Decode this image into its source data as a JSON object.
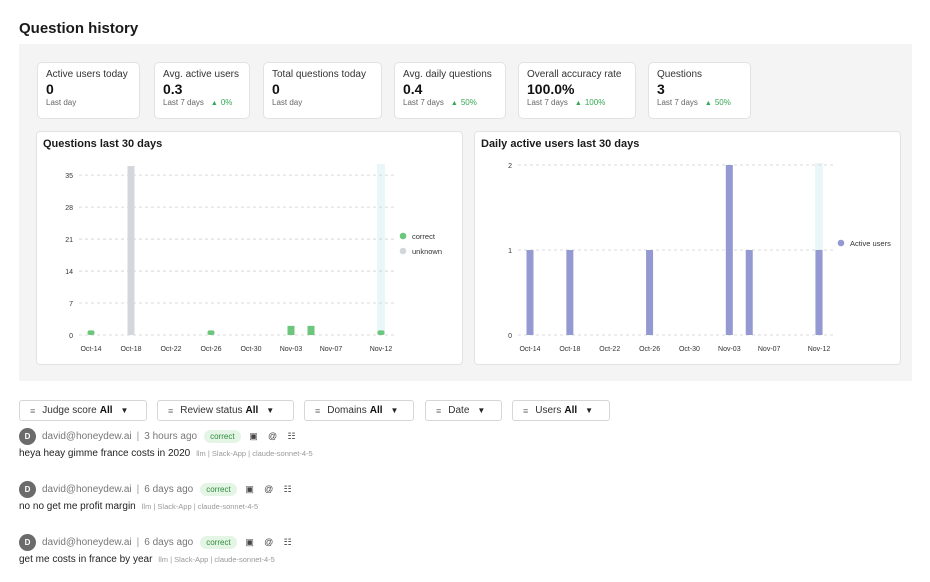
{
  "page": {
    "title": "Question history"
  },
  "stats": [
    {
      "label": "Active users today",
      "value": "0",
      "period": "Last day",
      "delta": ""
    },
    {
      "label": "Avg. active users",
      "value": "0.3",
      "period": "Last 7 days",
      "delta": "0%"
    },
    {
      "label": "Total questions today",
      "value": "0",
      "period": "Last day",
      "delta": ""
    },
    {
      "label": "Avg. daily questions",
      "value": "0.4",
      "period": "Last 7 days",
      "delta": "50%"
    },
    {
      "label": "Overall accuracy rate",
      "value": "100.0%",
      "period": "Last 7 days",
      "delta": "100%"
    },
    {
      "label": "Questions",
      "value": "3",
      "period": "Last 7 days",
      "delta": "50%"
    }
  ],
  "chart_data": [
    {
      "type": "bar",
      "title": "Questions last 30 days",
      "x_tick_labels": [
        "Oct-14",
        "Oct-18",
        "Oct-22",
        "Oct-26",
        "Oct-30",
        "Nov-03",
        "Nov-07",
        "Nov-12"
      ],
      "ylim": [
        0,
        37
      ],
      "y_ticks": [
        0,
        7,
        14,
        21,
        28,
        35
      ],
      "grid": true,
      "legend_position": "right",
      "series": [
        {
          "name": "correct",
          "color": "#6cc77d",
          "points": [
            {
              "x": "Oct-14",
              "y": 1
            },
            {
              "x": "Oct-26",
              "y": 1
            },
            {
              "x": "Nov-03",
              "y": 2
            },
            {
              "x": "Nov-05",
              "y": 2
            },
            {
              "x": "Nov-12",
              "y": 1
            }
          ]
        },
        {
          "name": "unknown",
          "color": "#d3d6da",
          "points": [
            {
              "x": "Oct-18",
              "y": 40
            }
          ]
        }
      ],
      "highlight": {
        "x": "Nov-12",
        "color": "#eaf7f8"
      }
    },
    {
      "type": "bar",
      "title": "Daily active users last 30 days",
      "x_tick_labels": [
        "Oct-14",
        "Oct-18",
        "Oct-22",
        "Oct-26",
        "Oct-30",
        "Nov-03",
        "Nov-07",
        "Nov-12"
      ],
      "ylim": [
        0,
        2
      ],
      "y_ticks": [
        0,
        1,
        2
      ],
      "grid": true,
      "legend_position": "right",
      "series": [
        {
          "name": "Active users",
          "color": "#9499d1",
          "points": [
            {
              "x": "Oct-14",
              "y": 1
            },
            {
              "x": "Oct-18",
              "y": 1
            },
            {
              "x": "Oct-26",
              "y": 1
            },
            {
              "x": "Nov-03",
              "y": 2
            },
            {
              "x": "Nov-05",
              "y": 1
            },
            {
              "x": "Nov-12",
              "y": 1
            }
          ]
        }
      ],
      "highlight": {
        "x": "Nov-12",
        "color": "#eaf7f8"
      }
    }
  ],
  "filters": [
    {
      "label": "Judge score",
      "value": "All"
    },
    {
      "label": "Review status",
      "value": "All"
    },
    {
      "label": "Domains",
      "value": "All"
    },
    {
      "label": "Date",
      "value": ""
    },
    {
      "label": "Users",
      "value": "All"
    }
  ],
  "questions": [
    {
      "avatar": "D",
      "user": "david@honeydew.ai",
      "time": "3 hours ago",
      "status": "correct",
      "text": "heya heay gimme france costs in 2020",
      "tags": "llm | Slack-App | claude-sonnet-4-5"
    },
    {
      "avatar": "D",
      "user": "david@honeydew.ai",
      "time": "6 days ago",
      "status": "correct",
      "text": "no no get me profit margin",
      "tags": "llm | Slack-App | claude-sonnet-4-5"
    },
    {
      "avatar": "D",
      "user": "david@honeydew.ai",
      "time": "6 days ago",
      "status": "correct",
      "text": "get me costs in france by year",
      "tags": "llm | Slack-App | claude-sonnet-4-5"
    }
  ]
}
